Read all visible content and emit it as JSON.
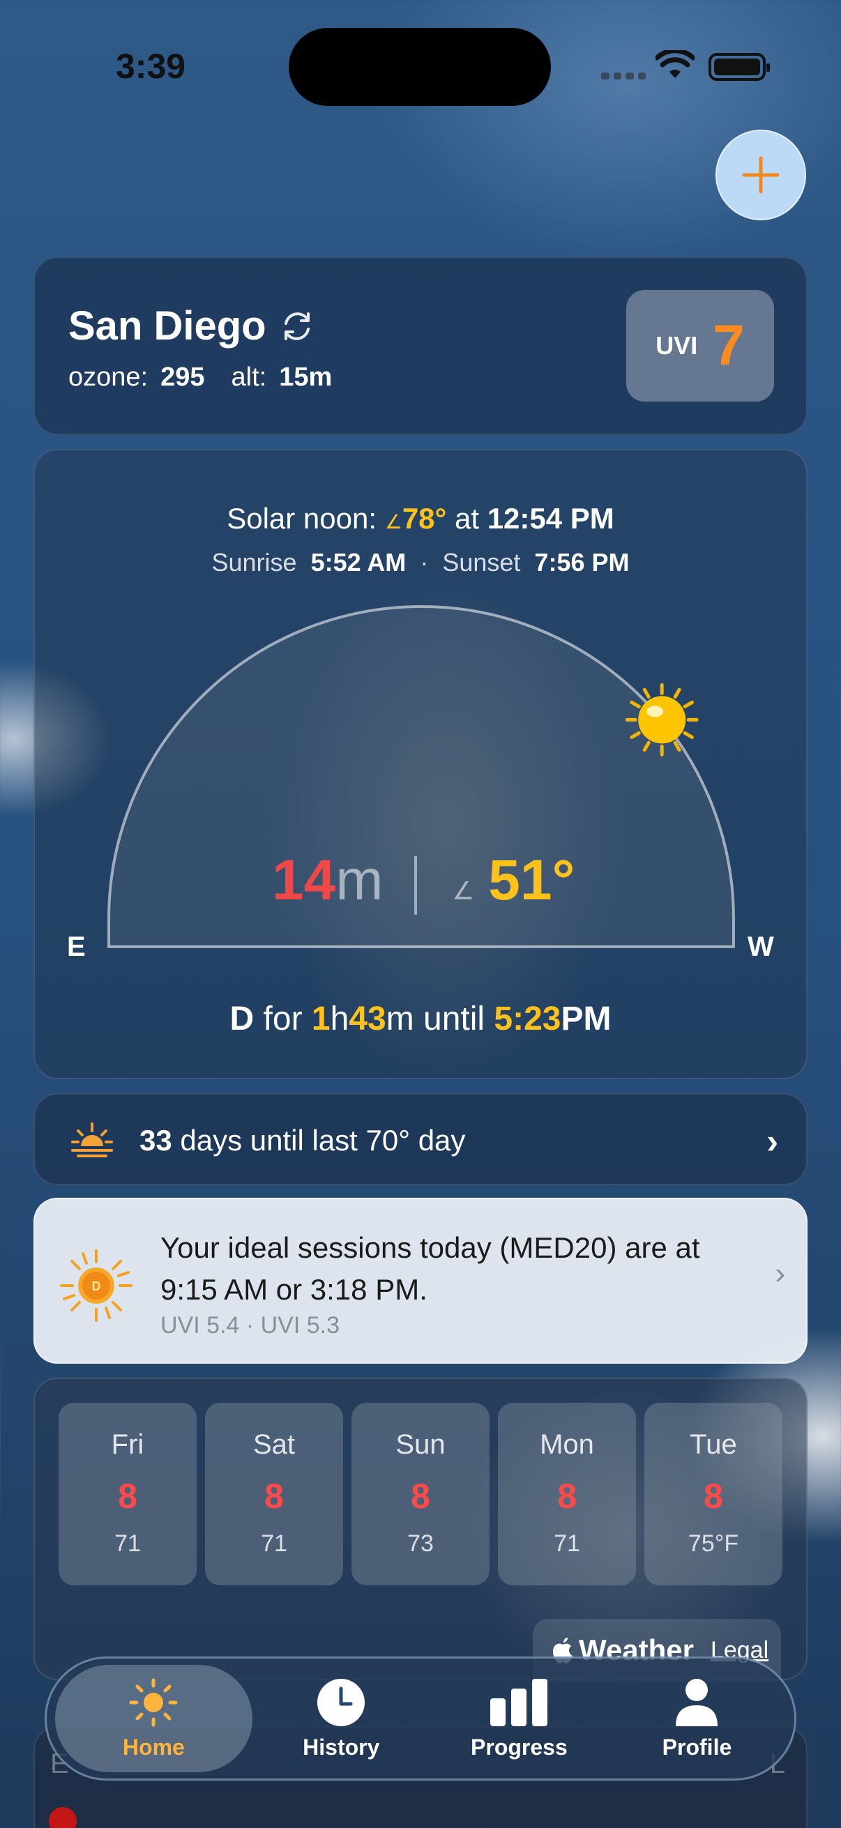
{
  "status_bar": {
    "time": "3:39"
  },
  "location": {
    "city": "San Diego",
    "ozone_label": "ozone:",
    "ozone_value": "295",
    "alt_label": "alt:",
    "alt_value": "15m",
    "uvi_label": "UVI",
    "uvi_value": "7"
  },
  "solar": {
    "noon_label": "Solar noon:",
    "noon_angle": "78°",
    "noon_at": "at",
    "noon_time": "12:54 PM",
    "sunrise_label": "Sunrise",
    "sunrise_time": "5:52 AM",
    "sep": "·",
    "sunset_label": "Sunset",
    "sunset_time": "7:56 PM",
    "minutes_value": "14",
    "minutes_unit": "m",
    "elevation": "51°",
    "east": "E",
    "west": "W",
    "d_label": "D",
    "d_for": "for",
    "d_hours": "1",
    "d_h": "h",
    "d_mins": "43",
    "d_m": "m until",
    "d_until_time": "5:23",
    "d_pm": "PM",
    "sun_position_fraction": 0.78
  },
  "last_day": {
    "count": "33",
    "text": "days until last 70° day"
  },
  "session": {
    "title": "Your ideal sessions today (MED20) are at 9:15 AM or 3:18 PM.",
    "subtitle": "UVI 5.4 · UVI 5.3",
    "badge_letter": "D"
  },
  "forecast": {
    "days": [
      {
        "day": "Fri",
        "uvi": "8",
        "temp": "71"
      },
      {
        "day": "Sat",
        "uvi": "8",
        "temp": "71"
      },
      {
        "day": "Sun",
        "uvi": "8",
        "temp": "73"
      },
      {
        "day": "Mon",
        "uvi": "8",
        "temp": "71"
      },
      {
        "day": "Tue",
        "uvi": "8",
        "temp": "75°F"
      }
    ],
    "weather_brand": "Weather",
    "legal": "Legal"
  },
  "peek": {
    "left": "E",
    "right": "L"
  },
  "tabs": [
    {
      "label": "Home",
      "active": true
    },
    {
      "label": "History",
      "active": false
    },
    {
      "label": "Progress",
      "active": false
    },
    {
      "label": "Profile",
      "active": false
    }
  ],
  "colors": {
    "accent_orange": "#ff8a1f",
    "sun_yellow": "#ffc21a",
    "uvi_red": "#ff4a4a"
  }
}
